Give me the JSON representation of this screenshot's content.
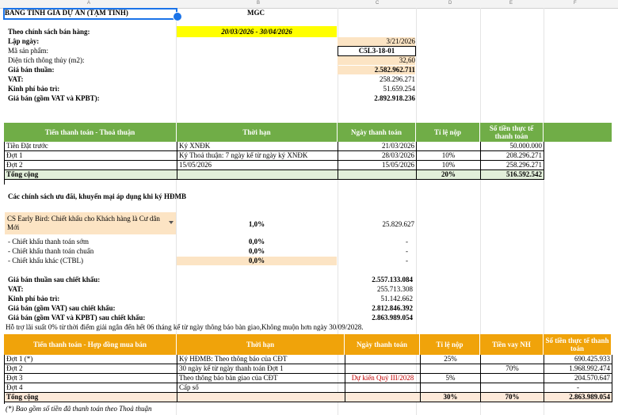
{
  "columns": [
    "A",
    "B",
    "C",
    "D",
    "E",
    "F"
  ],
  "title": "BẢNG TÍNH GIÁ DỰ ÁN (TẠM TÍNH)",
  "project_code": "MGC",
  "policy_label": "Theo chính sách bán hàng:",
  "policy_period": "20/03/2026 - 30/04/2026",
  "info": [
    {
      "label": "Lập ngày:",
      "value": "3/21/2026",
      "bold": true
    },
    {
      "label": "Mã sản phẩm:",
      "value": "C5L3-18-01",
      "bold": false
    },
    {
      "label": "Diện tích thông thủy (m2):",
      "value": "32,60",
      "bold": false
    },
    {
      "label": "Giá bán thuần:",
      "value": "2.582.962.711",
      "bold": true
    },
    {
      "label": "VAT:",
      "value": "258.296.271",
      "bold": true
    },
    {
      "label": "Kinh phí bảo trì:",
      "value": "51.659.254",
      "bold": true
    },
    {
      "label": "Giá bán (gồm VAT và KPBT):",
      "value": "2.892.918.236",
      "bold": true
    }
  ],
  "table1": {
    "headers": [
      "Tiến thanh toán - Thoả thuận",
      "Thời hạn",
      "Ngày thanh toán",
      "Tỉ lệ nộp",
      "Số tiền thực tế thanh toán"
    ],
    "rows": [
      {
        "stage": "Tiền Đặt trước",
        "term": "Ký XNĐK",
        "date": "21/03/2026",
        "rate": "",
        "amount": "50.000.000"
      },
      {
        "stage": "Đợt 1",
        "term": "Ký Thoả thuận: 7 ngày kể từ ngày ký XNĐK",
        "date": "28/03/2026",
        "rate": "10%",
        "amount": "208.296.271"
      },
      {
        "stage": "Đợt 2",
        "term": "15/05/2026",
        "date": "15/05/2026",
        "rate": "10%",
        "amount": "258.296.271"
      }
    ],
    "total": {
      "label": "Tổng cộng",
      "rate": "20%",
      "amount": "516.592.542"
    }
  },
  "discount_heading": "Các chính sách ưu đãi, khuyến mại áp dụng khi ký HĐMB",
  "early_bird": {
    "label": "CS Early Bird: Chiết khấu cho Khách hàng là Cư dân Mới",
    "rate": "1,0%",
    "amount": "25.829.627"
  },
  "discounts": [
    {
      "label": "- Chiết khấu thanh toán sớm",
      "rate": "0,0%",
      "amount": "-"
    },
    {
      "label": "- Chiết khấu thanh toán chuẩn",
      "rate": "0,0%",
      "amount": "-"
    },
    {
      "label": "- Chiết khấu khác (CTBL)",
      "rate": "0,0%",
      "amount": "-"
    }
  ],
  "after_discount": [
    {
      "label": "Giá bán thuần sau chiết khấu:",
      "value": "2.557.133.084"
    },
    {
      "label": "VAT:",
      "value": "255.713.308"
    },
    {
      "label": "Kinh phí bảo trì:",
      "value": "51.142.662"
    },
    {
      "label": "Giá bán (gồm VAT) sau chiết khấu:",
      "value": "2.812.846.392"
    },
    {
      "label": "Giá bán (gồm VAT và KPBT) sau chiết khấu:",
      "value": "2.863.989.054"
    }
  ],
  "interest_note": "Hỗ trợ lãi suất 0% từ thời điểm giải ngân đến hết 06 tháng kể từ ngày thông báo bàn giao,Không muộn hơn ngày 30/09/2028.",
  "table2": {
    "headers": [
      "Tiến thanh toán - Hợp đồng mua bán",
      "Thời hạn",
      "Ngày thanh toán",
      "Tỉ lệ nộp",
      "Tiền vay NH",
      "Số tiền thực tế thanh toán"
    ],
    "rows": [
      {
        "stage": "Đợt 1 (*)",
        "term": "Ký HĐMB: Theo thông báo của CĐT",
        "date": "",
        "rate": "25%",
        "loan": "",
        "amount": "690.425.933"
      },
      {
        "stage": "Đợt 2",
        "term": "30 ngày kể từ ngày thanh toán Đợt 1",
        "date": "",
        "rate": "",
        "loan": "70%",
        "amount": "1.968.992.474"
      },
      {
        "stage": "Đợt 3",
        "term": "Theo thông báo bàn giao của CĐT",
        "date": "Dự kiến Quý III/2028",
        "rate": "5%",
        "loan": "",
        "amount": "204.570.647"
      },
      {
        "stage": "Đợt 4",
        "term": "Cấp sổ",
        "date": "",
        "rate": "",
        "loan": "",
        "amount": "-"
      }
    ],
    "total": {
      "label": "Tổng cộng",
      "rate": "30%",
      "loan": "70%",
      "amount": "2.863.989.054"
    }
  },
  "footnote": "(*) Bao gồm số tiền đã thanh toán theo Thoả thuận",
  "colors": {
    "header_green": "#70ad47",
    "header_orange": "#f0a30a",
    "highlight_yellow": "#ffff00",
    "input_peach": "#fce4c4",
    "selection_blue": "#1a73e8"
  }
}
